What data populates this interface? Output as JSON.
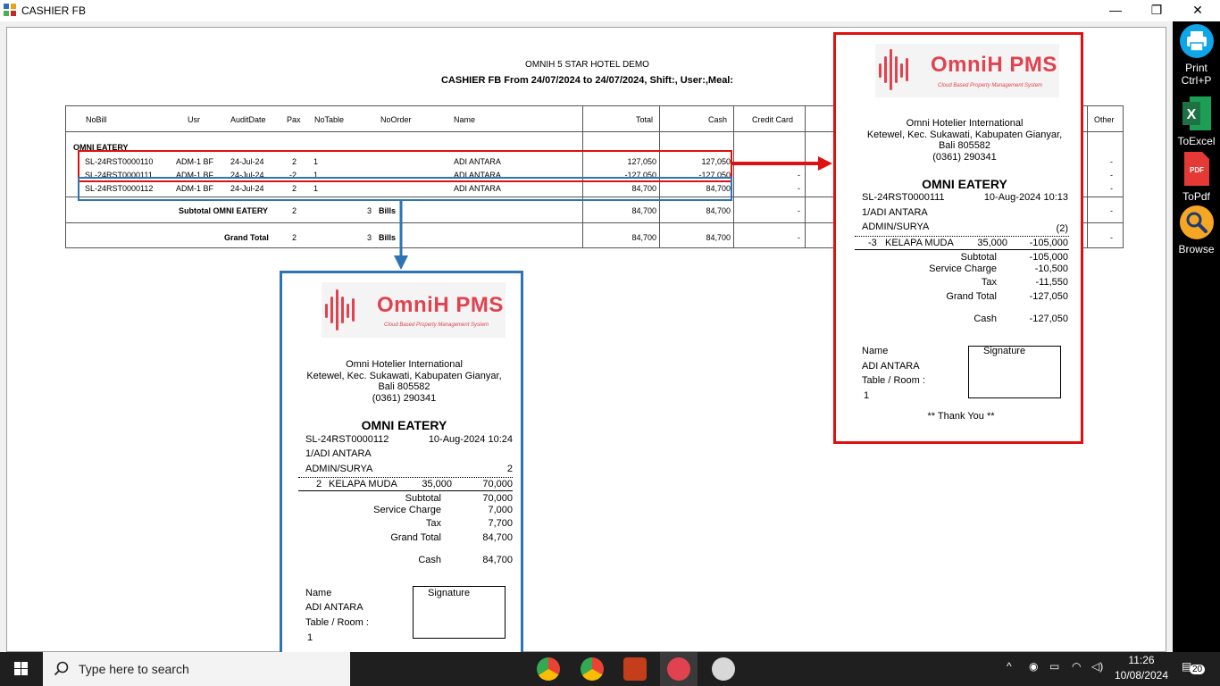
{
  "window": {
    "title": "CASHIER FB",
    "minimize_glyph": "—",
    "maximize_glyph": "❐",
    "close_glyph": "✕"
  },
  "report": {
    "hotel": "OMNIH 5 STAR HOTEL DEMO",
    "subtitle": "CASHIER FB From 24/07/2024 to 24/07/2024, Shift:, User:,Meal:",
    "columns": [
      "NoBill",
      "Usr",
      "AuditDate",
      "Pax",
      "NoTable",
      "NoOrder",
      "Name",
      "Total",
      "Cash",
      "Credit Card",
      "Other"
    ],
    "section": "OMNI EATERY",
    "rows": [
      {
        "nobill": "SL-24RST0000110",
        "usr": "ADM-1 BF",
        "date": "24-Jul-24",
        "pax": "2",
        "table": "1",
        "name": "ADI ANTARA",
        "total": "127,050",
        "cash": "127,050",
        "cc": "",
        "other": "-"
      },
      {
        "nobill": "SL-24RST0000111",
        "usr": "ADM-1 BF",
        "date": "24-Jul-24",
        "pax": "-2",
        "table": "1",
        "name": "ADI ANTARA",
        "total": "-127,050",
        "cash": "-127,050",
        "cc": "-",
        "other": "-"
      },
      {
        "nobill": "SL-24RST0000112",
        "usr": "ADM-1 BF",
        "date": "24-Jul-24",
        "pax": "2",
        "table": "1",
        "name": "ADI ANTARA",
        "total": "84,700",
        "cash": "84,700",
        "cc": "-",
        "other": "-"
      }
    ],
    "subtotal": {
      "label": "Subtotal OMNI EATERY",
      "pax": "2",
      "bills": "3",
      "bills_label": "Bills",
      "total": "84,700",
      "cash": "84,700",
      "cc": "-",
      "other": "-"
    },
    "grandtotal": {
      "label": "Grand Total",
      "pax": "2",
      "bills": "3",
      "bills_label": "Bills",
      "total": "84,700",
      "cash": "84,700",
      "cc": "-",
      "other": "-"
    }
  },
  "toolbar": {
    "print_label": "Print",
    "print_shortcut": "Ctrl+P",
    "excel_label": "ToExcel",
    "pdf_label": "ToPdf",
    "pdf_badge": "PDF",
    "browse_label": "Browse"
  },
  "receipt_common": {
    "logo_text": "OmniH PMS",
    "logo_tagline": "Cloud Based Property Management System",
    "company": "Omni Hotelier International",
    "address1": "Ketewel, Kec. Sukawati, Kabupaten Gianyar,",
    "address2": "Bali 805582",
    "phone": "(0361) 290341",
    "outlet": "OMNI EATERY",
    "subtotal_label": "Subtotal",
    "service_label": "Service Charge",
    "tax_label": "Tax",
    "grand_label": "Grand Total",
    "cash_label": "Cash",
    "name_label": "Name",
    "signature_label": "Signature",
    "table_room_label": "Table / Room :",
    "thanks": "** Thank You **"
  },
  "receipt_112": {
    "bill_no": "SL-24RST0000112",
    "datetime": "10-Aug-2024  10:24",
    "table_guest": "1/ADI ANTARA",
    "admin": "ADMIN/SURYA",
    "pax": "2",
    "item_qty": "2",
    "item_name": "KELAPA MUDA",
    "item_price": "35,000",
    "item_amount": "70,000",
    "subtotal": "70,000",
    "service": "7,000",
    "tax": "7,700",
    "grand": "84,700",
    "cash": "84,700",
    "guest": "ADI ANTARA",
    "table": "1"
  },
  "receipt_111": {
    "bill_no": "SL-24RST0000111",
    "datetime": "10-Aug-2024  10:13",
    "table_guest": "1/ADI ANTARA",
    "admin": "ADMIN/SURYA",
    "pax": "(2)",
    "item_qty": "-3",
    "item_name": "KELAPA MUDA",
    "item_price": "35,000",
    "item_amount": "-105,000",
    "subtotal": "-105,000",
    "service": "-10,500",
    "tax": "-11,550",
    "grand": "-127,050",
    "cash": "-127,050",
    "guest": "ADI ANTARA",
    "table": "1"
  },
  "taskbar": {
    "search_placeholder": "Type here to search",
    "time": "11:26",
    "date": "10/08/2024",
    "notifications": "20"
  },
  "colors": {
    "highlight_red": "#e01010",
    "highlight_blue": "#2e74b5",
    "logo_red": "#e0424f"
  }
}
